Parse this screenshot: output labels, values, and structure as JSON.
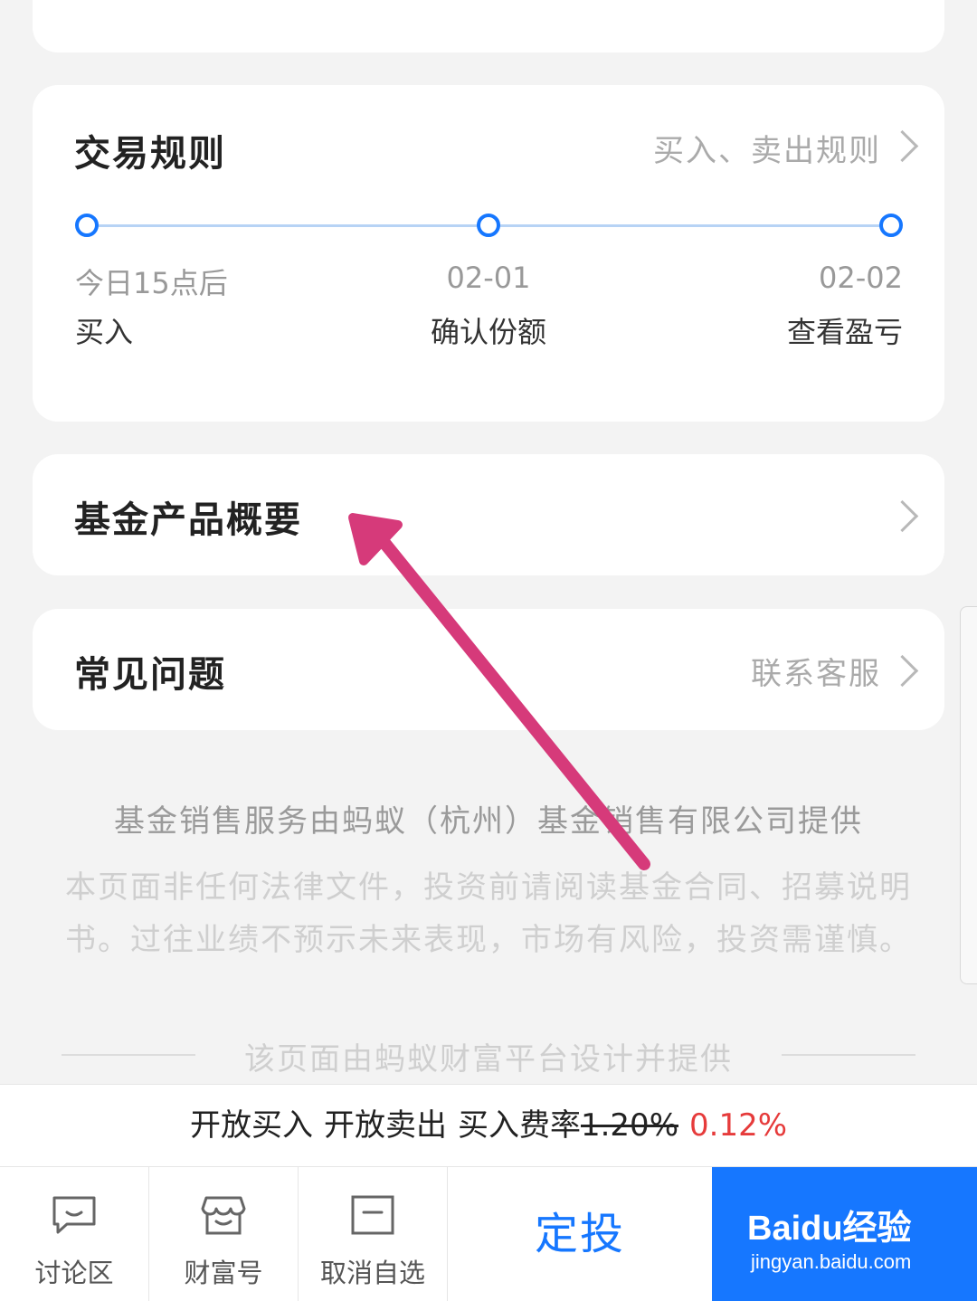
{
  "trade_rules": {
    "title": "交易规则",
    "link": "买入、卖出规则",
    "steps": [
      {
        "date": "今日15点后",
        "label": "买入"
      },
      {
        "date": "02-01",
        "label": "确认份额"
      },
      {
        "date": "02-02",
        "label": "查看盈亏"
      }
    ]
  },
  "fund_summary": {
    "title": "基金产品概要"
  },
  "faq": {
    "title": "常见问题",
    "link": "联系客服"
  },
  "disclaimer": {
    "provider": "基金销售服务由蚂蚁（杭州）基金销售有限公司提供",
    "notice": "本页面非任何法律文件，投资前请阅读基金合同、招募说明书。过往业绩不预示未来表现，市场有风险，投资需谨慎。",
    "footer": "该页面由蚂蚁财富平台设计并提供"
  },
  "fee_bar": {
    "open_buy": "开放买入",
    "open_sell": "开放卖出",
    "fee_label": "买入费率",
    "old_rate": "1.20%",
    "new_rate": "0.12%"
  },
  "bottom_nav": {
    "items": [
      {
        "label": "讨论区",
        "icon": "chat-icon"
      },
      {
        "label": "财富号",
        "icon": "store-icon"
      },
      {
        "label": "取消自选",
        "icon": "remove-watchlist-icon"
      }
    ],
    "auto_invest": "定投"
  },
  "watermark": {
    "title": "Baidu经验",
    "url": "jingyan.baidu.com"
  },
  "colors": {
    "accent": "#1677ff",
    "price_red": "#e63b3b",
    "annotation_arrow": "#d63a7a"
  }
}
